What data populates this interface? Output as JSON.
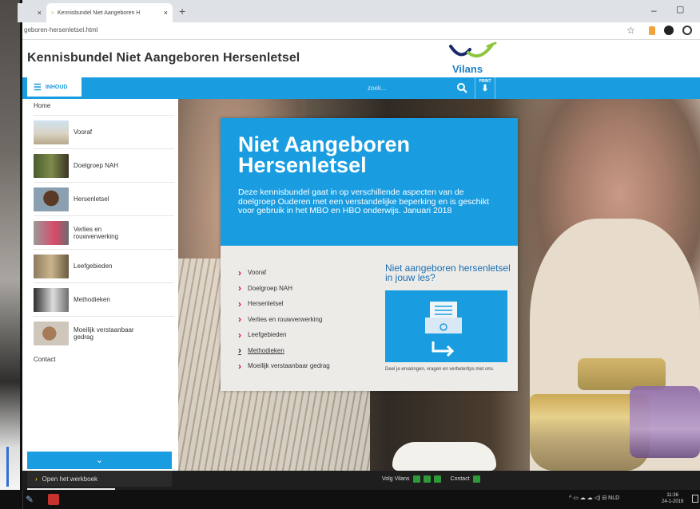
{
  "browser": {
    "tabs": [
      {
        "label": "",
        "close": "×"
      },
      {
        "label": "Kennisbundel Niet Aangeboren H",
        "close": "×"
      }
    ],
    "new_tab": "+",
    "url": "geboren-hersenletsel.html"
  },
  "site": {
    "title": "Kennisbundel Niet Aangeboren Hersenletsel",
    "logo_text": "Vilans"
  },
  "nav": {
    "menu_label": "INHOUD",
    "search_placeholder": "zoek...",
    "print_label": "PRINT"
  },
  "sidebar": {
    "home": "Home",
    "items": [
      {
        "label": "Vooraf"
      },
      {
        "label": "Doelgroep NAH"
      },
      {
        "label": "Hersenletsel"
      },
      {
        "label": "Verlies en rouwverwerking"
      },
      {
        "label": "Leefgebieden"
      },
      {
        "label": "Methodieken"
      },
      {
        "label": "Moeilijk verstaanbaar gedrag"
      }
    ],
    "contact": "Contact",
    "expand": "⌄"
  },
  "card": {
    "title": "Niet Aangeboren Hersenletsel",
    "intro": "Deze kennisbundel gaat in op verschillende aspecten van de doelgroep Ouderen met een verstandelijke beperking en is geschikt voor gebruik in het MBO en HBO onderwijs. Januari 2018",
    "links": [
      {
        "label": "Vooraf"
      },
      {
        "label": "Doelgroep NAH"
      },
      {
        "label": "Hersenletsel"
      },
      {
        "label": "Verlies en rouwverwerking"
      },
      {
        "label": "Leefgebieden"
      },
      {
        "label": "Methodieken"
      },
      {
        "label": "Moeilijk verstaanbaar gedrag"
      }
    ],
    "active_link": "Methodieken",
    "cta_title": "Niet aangeboren hersenletsel in jouw les?",
    "cta_note": "Deel je ervaringen, vragen en verbetertips met ons."
  },
  "footer": {
    "workbook": "Open het werkboek",
    "follow": "Volg Vilans",
    "contact": "Contact"
  },
  "taskbar": {
    "language": "NLD",
    "time": "11:36",
    "date": "24-1-2019"
  },
  "colors": {
    "accent": "#1a9de0",
    "link_chevron": "#d10a57",
    "logo_green": "#8cc63f",
    "logo_navy": "#1b2a6b"
  }
}
